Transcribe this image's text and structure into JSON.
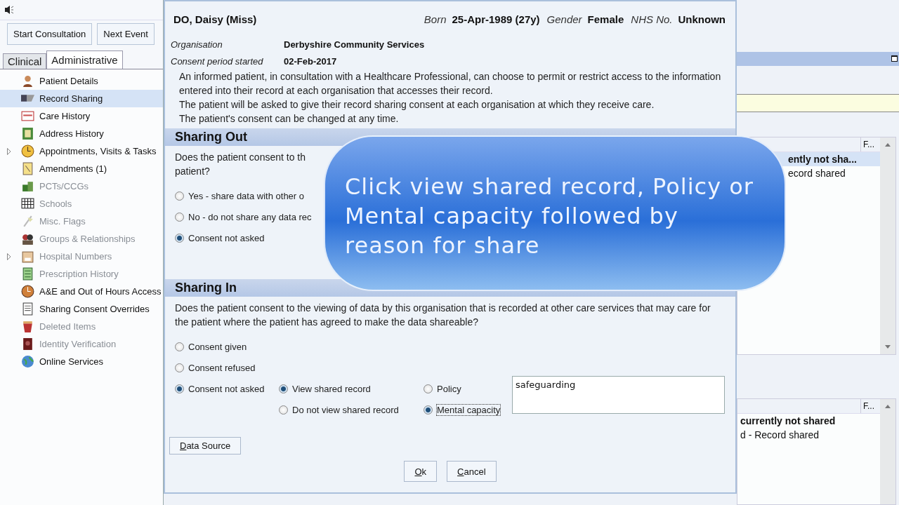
{
  "toolbar": {
    "buttons": [
      "Start Consultation",
      "Next Event"
    ]
  },
  "tabs": [
    {
      "label": "Clinical",
      "selected": false
    },
    {
      "label": "Administrative",
      "selected": true
    }
  ],
  "tree": [
    {
      "label": "Patient Details",
      "selected": false,
      "disabled": false,
      "expandable": false
    },
    {
      "label": "Record Sharing",
      "selected": true,
      "disabled": false,
      "expandable": false
    },
    {
      "label": "Care History",
      "selected": false,
      "disabled": false,
      "expandable": false
    },
    {
      "label": "Address History",
      "selected": false,
      "disabled": false,
      "expandable": false
    },
    {
      "label": "Appointments, Visits & Tasks",
      "selected": false,
      "disabled": false,
      "expandable": true
    },
    {
      "label": "Amendments (1)",
      "selected": false,
      "disabled": false,
      "expandable": false
    },
    {
      "label": "PCTs/CCGs",
      "selected": false,
      "disabled": true,
      "expandable": false
    },
    {
      "label": "Schools",
      "selected": false,
      "disabled": true,
      "expandable": false
    },
    {
      "label": "Misc. Flags",
      "selected": false,
      "disabled": true,
      "expandable": false
    },
    {
      "label": "Groups & Relationships",
      "selected": false,
      "disabled": true,
      "expandable": false
    },
    {
      "label": "Hospital Numbers",
      "selected": false,
      "disabled": true,
      "expandable": true
    },
    {
      "label": "Prescription History",
      "selected": false,
      "disabled": true,
      "expandable": false
    },
    {
      "label": "A&E and Out of Hours Access",
      "selected": false,
      "disabled": false,
      "expandable": false
    },
    {
      "label": "Sharing Consent Overrides",
      "selected": false,
      "disabled": false,
      "expandable": false
    },
    {
      "label": "Deleted Items",
      "selected": false,
      "disabled": true,
      "expandable": false
    },
    {
      "label": "Identity Verification",
      "selected": false,
      "disabled": true,
      "expandable": false
    },
    {
      "label": "Online Services",
      "selected": false,
      "disabled": false,
      "expandable": false
    }
  ],
  "dialog": {
    "patient": {
      "name": "DO, Daisy (Miss)",
      "born_label": "Born",
      "born": "25-Apr-1989 (27y)",
      "gender_label": "Gender",
      "gender": "Female",
      "nhs_label": "NHS No.",
      "nhs": "Unknown"
    },
    "organisation_label": "Organisation",
    "organisation": "Derbyshire Community Services",
    "consent_label": "Consent period started",
    "consent_started": "02-Feb-2017",
    "info": [
      "An informed patient, in consultation with a Healthcare Professional, can choose to permit or restrict access to the information entered into their record at each organisation that accesses their record.",
      "The patient will be asked to give their record sharing consent at each organisation at which they receive care.",
      "The patient's consent can be changed at any time."
    ],
    "sharing_out": {
      "title": "Sharing Out",
      "question_lines": [
        "Does the patient consent to th",
        "patient?"
      ],
      "options": [
        {
          "label": "Yes - share data with other o",
          "selected": false
        },
        {
          "label": "No - do not share any data rec",
          "selected": false
        },
        {
          "label": "Consent not asked",
          "selected": true
        }
      ]
    },
    "sharing_in": {
      "title": "Sharing In",
      "question": "Does the patient consent to the viewing of data by this organisation that is recorded at other care services that may care for the patient where the patient has agreed to make the data shareable?",
      "options": [
        {
          "label": "Consent given",
          "selected": false
        },
        {
          "label": "Consent refused",
          "selected": false
        },
        {
          "label": "Consent not asked",
          "selected": true
        }
      ],
      "view_options": [
        {
          "label": "View shared record",
          "selected": true
        },
        {
          "label": "Do not view shared record",
          "selected": false
        }
      ],
      "reason_options": [
        {
          "label": "Policy",
          "selected": false,
          "focused": false
        },
        {
          "label": "Mental capacity",
          "selected": true,
          "focused": true
        }
      ],
      "reason_text": "safeguarding"
    },
    "data_source_button": "Data Source",
    "ok_button": "Ok",
    "cancel_button": "Cancel"
  },
  "background_window": {
    "list_1": {
      "column_2": "F...",
      "rows": [
        {
          "text": "ently not sha...",
          "selected": true
        },
        {
          "text": "ecord shared",
          "selected": false
        }
      ]
    },
    "list_2": {
      "column_2": "F...",
      "rows": [
        {
          "text": "currently not shared",
          "selected": false,
          "bold": true
        },
        {
          "text": "d - Record shared",
          "selected": false,
          "bold": false
        }
      ]
    }
  },
  "callout": {
    "text": "Click view shared record, Policy or Mental capacity followed by reason for share"
  }
}
